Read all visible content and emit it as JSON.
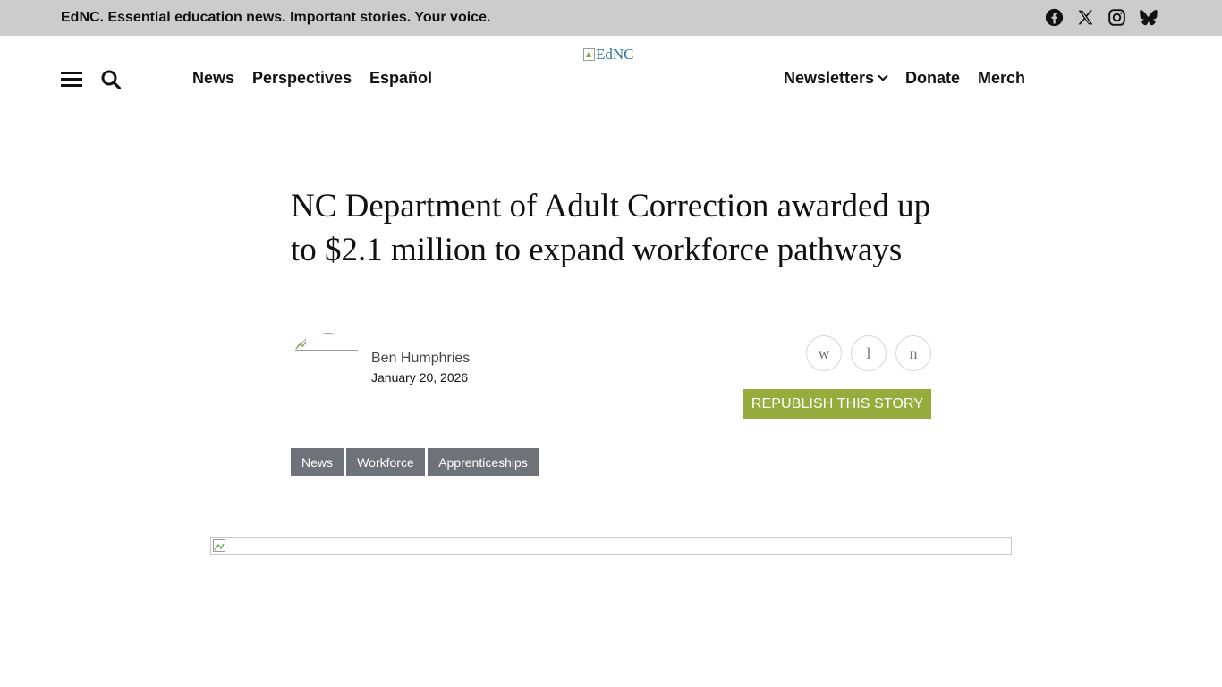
{
  "topbar": {
    "tagline": "EdNC. Essential education news. Important stories. Your voice.",
    "social": [
      "facebook-icon",
      "x-icon",
      "instagram-icon",
      "bluesky-icon"
    ],
    "background": "#cccccc"
  },
  "header": {
    "nav_left": [
      "News",
      "Perspectives",
      "Español"
    ],
    "logo_alt": "EdNC",
    "nav_right": {
      "newsletters": "Newsletters",
      "donate": "Donate",
      "merch": "Merch"
    }
  },
  "article": {
    "title": "NC Department of Adult Correction awarded up to $2.1 million to expand workforce pathways",
    "author": "Ben Humphries",
    "date": "January 20, 2026",
    "share_buttons": [
      "w",
      "l",
      "n"
    ],
    "republish_label": "REPUBLISH THIS STORY",
    "tags": [
      "News",
      "Workforce",
      "Apprenticeships"
    ]
  },
  "colors": {
    "accent_green": "#96ac3d",
    "tag_gray": "#6e737a",
    "link_blue": "#2f6f9f"
  }
}
